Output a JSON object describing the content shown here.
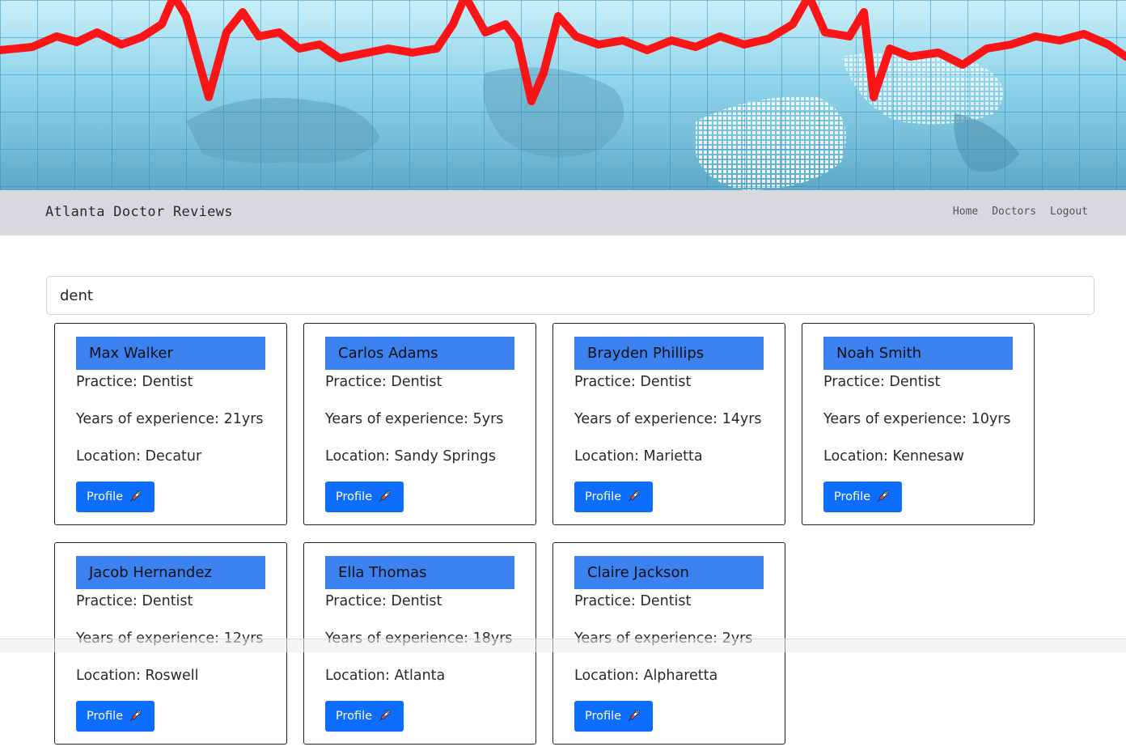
{
  "navbar": {
    "brand": "Atlanta Doctor Reviews",
    "links": [
      "Home",
      "Doctors",
      "Logout"
    ]
  },
  "search": {
    "value": "dent"
  },
  "icons": {
    "profile_button_icon": "syringe-icon",
    "banner": "heartbeat-ecg-banner"
  },
  "colors": {
    "accent": "#0d6efd",
    "name_bar": "#3b82f0",
    "navbar_bg": "#d8d9dd"
  },
  "doctors": [
    {
      "name": "Max Walker",
      "practice": "Practice: Dentist",
      "experience": "Years of experience: 21yrs",
      "location": "Location: Decatur",
      "button": "Profile"
    },
    {
      "name": "Carlos Adams",
      "practice": "Practice: Dentist",
      "experience": "Years of experience: 5yrs",
      "location": "Location: Sandy Springs",
      "button": "Profile"
    },
    {
      "name": "Brayden Phillips",
      "practice": "Practice: Dentist",
      "experience": "Years of experience: 14yrs",
      "location": "Location: Marietta",
      "button": "Profile"
    },
    {
      "name": "Noah Smith",
      "practice": "Practice: Dentist",
      "experience": "Years of experience: 10yrs",
      "location": "Location: Kennesaw",
      "button": "Profile"
    },
    {
      "name": "Jacob Hernandez",
      "practice": "Practice: Dentist",
      "experience": "Years of experience: 12yrs",
      "location": "Location: Roswell",
      "button": "Profile"
    },
    {
      "name": "Ella Thomas",
      "practice": "Practice: Dentist",
      "experience": "Years of experience: 18yrs",
      "location": "Location: Atlanta",
      "button": "Profile"
    },
    {
      "name": "Claire Jackson",
      "practice": "Practice: Dentist",
      "experience": "Years of experience: 2yrs",
      "location": "Location: Alpharetta",
      "button": "Profile"
    }
  ]
}
